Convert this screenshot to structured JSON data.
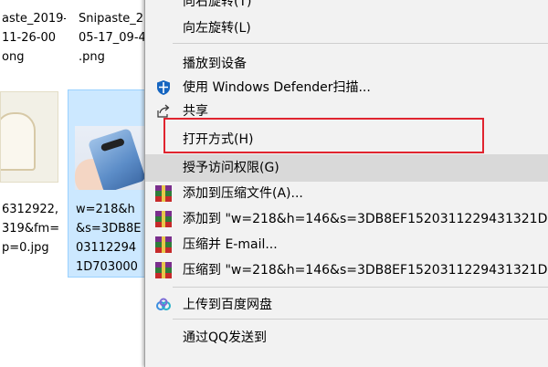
{
  "explorer": {
    "files": [
      {
        "name": "aste_2019-\n11-26-00\nong"
      },
      {
        "name": "Snipaste_2\n05-17_09-4\n.png"
      },
      {
        "name": "6312922,\n319&fm=\np=0.jpg"
      },
      {
        "name": "w=218&h\n&s=3DB8E\n03112294\n1D703000"
      }
    ]
  },
  "menu": {
    "items": [
      {
        "label": "向右旋转(T)"
      },
      {
        "label": "向左旋转(L)"
      },
      {
        "label": "播放到设备"
      },
      {
        "label": "使用 Windows Defender扫描...",
        "icon": "windows-defender-icon"
      },
      {
        "label": "共享",
        "icon": "share-icon"
      },
      {
        "label": "打开方式(H)"
      },
      {
        "label": "授予访问权限(G)"
      },
      {
        "label": "添加到压缩文件(A)...",
        "icon": "winrar-icon"
      },
      {
        "label": "添加到 \"w=218&h=146&s=3DB8EF1520311229431321D",
        "icon": "winrar-icon"
      },
      {
        "label": "压缩并 E-mail...",
        "icon": "winrar-icon"
      },
      {
        "label": "压缩到 \"w=218&h=146&s=3DB8EF1520311229431321D",
        "icon": "winrar-icon"
      },
      {
        "label": "上传到百度网盘",
        "icon": "baidu-netdisk-icon"
      },
      {
        "label": "通过QQ发送到"
      }
    ],
    "highlight_color": "#e0242f",
    "hover_item": "授予访问权限(G)"
  }
}
